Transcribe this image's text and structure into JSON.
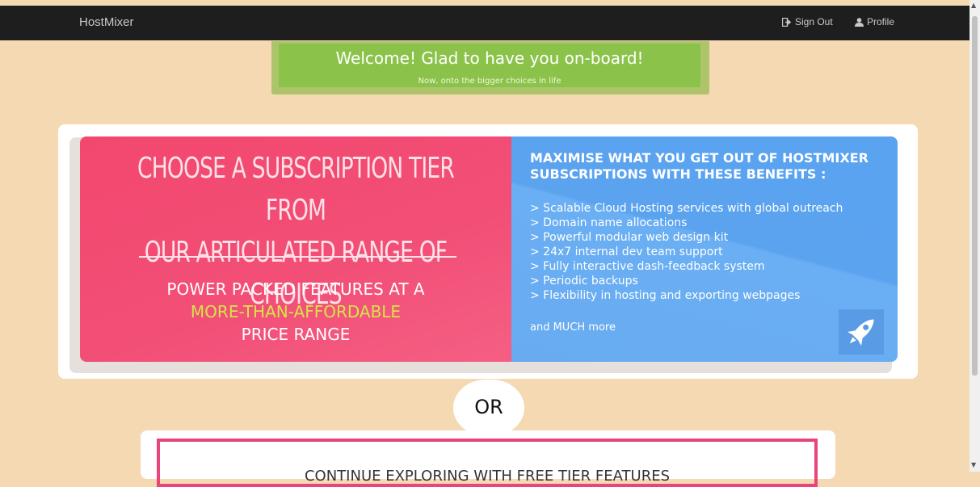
{
  "header": {
    "brand": "HostMixer",
    "sign_out_label": "Sign Out",
    "profile_label": "Profile"
  },
  "welcome": {
    "title": "Welcome! Glad to have you on-board!",
    "subtitle": "Now, onto the bigger choices in life"
  },
  "subscription": {
    "title_line1": "CHOOSE A SUBSCRIPTION TIER FROM",
    "title_line2": "OUR ARTICULATED RANGE OF CHOICES",
    "feature_line1": "POWER PACKED FEATURES AT A",
    "feature_highlight": "MORE-THAN-AFFORDABLE",
    "feature_line3": "PRICE RANGE"
  },
  "benefits": {
    "heading_line1": "MAXIMISE WHAT YOU GET OUT OF HOSTMIXER",
    "heading_line2": "SUBSCRIPTIONS WITH THESE BENEFITS :",
    "items": [
      "> Scalable Cloud Hosting services with global outreach",
      "> Domain name allocations",
      "> Powerful modular web design kit",
      "> 24x7 internal dev team support",
      "> Fully interactive dash-feedback system",
      "> Periodic backups",
      "> Flexibility in hosting and exporting webpages"
    ],
    "more": "and MUCH more",
    "icon": "rocket-icon"
  },
  "divider": {
    "or_label": "OR"
  },
  "free_tier": {
    "label": "CONTINUE EXPLORING WITH FREE TIER FEATURES"
  },
  "colors": {
    "navbar": "#1e1e1e",
    "page_bg": "#f5d9b2",
    "welcome_green": "#8bc34a",
    "tier_pink": "#f24f77",
    "benefits_blue": "#5aa3f0",
    "highlight": "#d7e34a"
  }
}
